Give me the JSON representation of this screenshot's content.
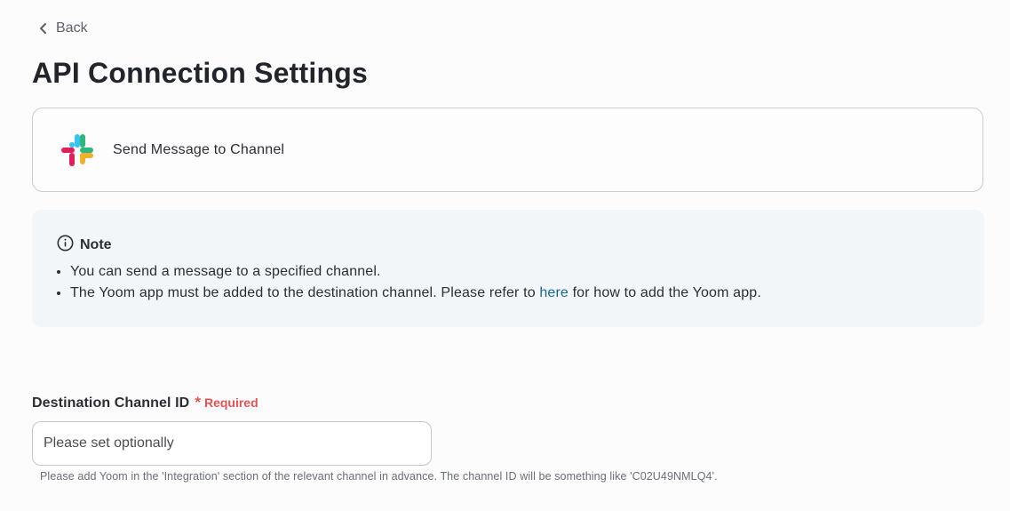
{
  "nav": {
    "back_label": "Back"
  },
  "page": {
    "title": "API Connection Settings"
  },
  "action": {
    "app_icon": "slack-logo",
    "label": "Send Message to Channel"
  },
  "note": {
    "icon": "info-icon",
    "title": "Note",
    "item1": "You can send a message to a specified channel.",
    "item2_before": "The Yoom app must be added to the destination channel. Please refer to ",
    "item2_link": "here",
    "item2_after": " for how to add the Yoom app.",
    "link_color": "#17698f"
  },
  "field": {
    "label": "Destination Channel ID",
    "required_marker": "*",
    "required_text": "Required",
    "placeholder": "Please set optionally",
    "value": "",
    "helper": "Please add Yoom in the 'Integration' section of the relevant channel in advance. The channel ID will be something like 'C02U49NMLQ4'.",
    "required_color": "#e25555"
  }
}
